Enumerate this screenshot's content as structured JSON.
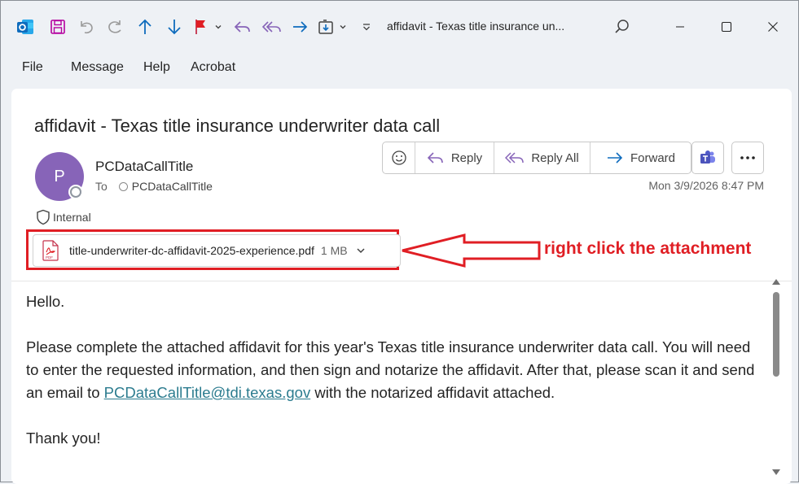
{
  "window": {
    "title": "affidavit - Texas title insurance un..."
  },
  "menu": {
    "items": [
      "File",
      "Message",
      "Help",
      "Acrobat"
    ]
  },
  "message": {
    "subject": "affidavit - Texas title insurance underwriter data call",
    "avatar_initial": "P",
    "avatar_color": "#8764b8",
    "sender": "PCDataCallTitle",
    "to_label": "To",
    "recipient": "PCDataCallTitle",
    "sensitivity": "Internal",
    "datetime": "Mon 3/9/2026 8:47 PM",
    "actions": {
      "reply": "Reply",
      "reply_all": "Reply All",
      "forward": "Forward"
    },
    "attachment": {
      "name": "title-underwriter-dc-affidavit-2025-experience.pdf",
      "size": "1 MB",
      "type": "PDF"
    },
    "body": {
      "greeting": "Hello.",
      "p1_before": "Please complete the attached affidavit for this year's Texas title insurance underwriter data call.  You will need to enter the requested information, and then sign and notarize the affidavit.  After that, please scan it and send an email to ",
      "email_link": "PCDataCallTitle@tdi.texas.gov",
      "p1_after": " with the notarized affidavit attached.",
      "closing": "Thank you!"
    }
  },
  "annotation": {
    "text": "right click the attachment",
    "color": "#e01e24"
  }
}
